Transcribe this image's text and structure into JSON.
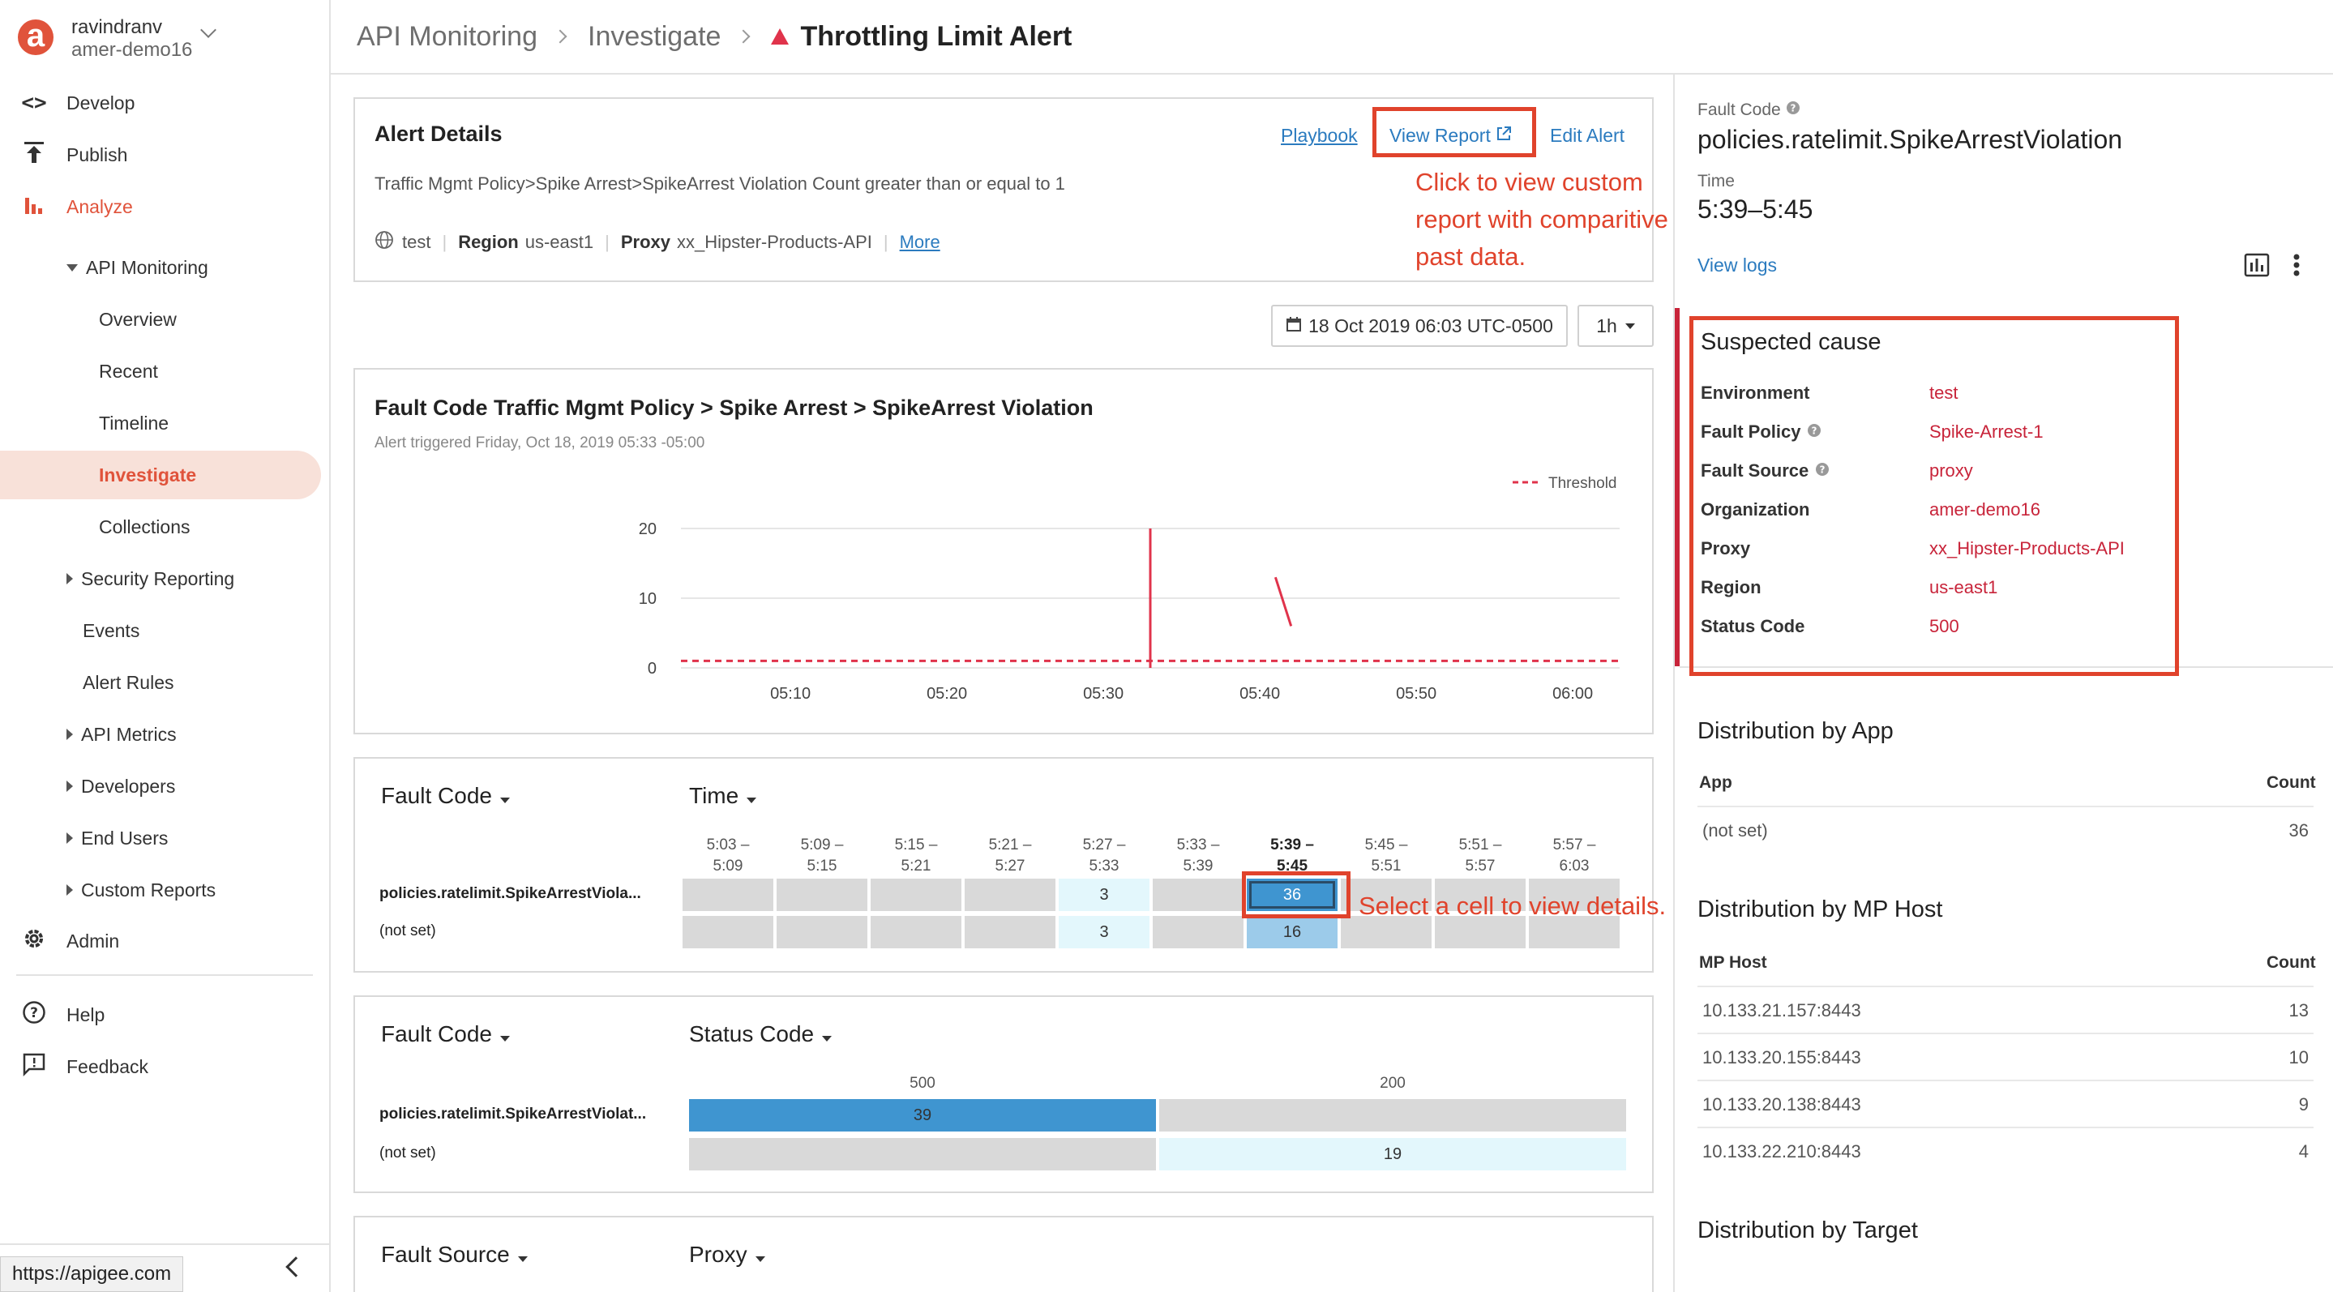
{
  "user": {
    "name": "ravindranv",
    "org": "amer-demo16"
  },
  "nav": {
    "develop": "Develop",
    "publish": "Publish",
    "analyze": "Analyze",
    "api_monitoring": "API Monitoring",
    "overview": "Overview",
    "recent": "Recent",
    "timeline": "Timeline",
    "investigate": "Investigate",
    "collections": "Collections",
    "security_reporting": "Security Reporting",
    "events": "Events",
    "alert_rules": "Alert Rules",
    "api_metrics": "API Metrics",
    "developers": "Developers",
    "end_users": "End Users",
    "custom_reports": "Custom Reports",
    "admin": "Admin",
    "help": "Help",
    "feedback": "Feedback"
  },
  "status_url": "https://apigee.com",
  "breadcrumb": {
    "b1": "API Monitoring",
    "b2": "Investigate",
    "current": "Throttling Limit Alert"
  },
  "alert": {
    "title": "Alert Details",
    "playbook": "Playbook",
    "view_report": "View Report",
    "edit_alert": "Edit Alert",
    "description": "Traffic Mgmt Policy>Spike Arrest>SpikeArrest Violation Count greater than or equal to 1",
    "env": "test",
    "region_label": "Region",
    "region_value": "us-east1",
    "proxy_label": "Proxy",
    "proxy_value": "xx_Hipster-Products-API",
    "more": "More"
  },
  "annotations": {
    "report_l1": "Click to view custom",
    "report_l2": "report with comparitive",
    "report_l3": "past data.",
    "cell": "Select a cell to view details."
  },
  "date_picker": "18 Oct 2019 06:03 UTC-0500",
  "range_picker": "1h",
  "chart_data": {
    "type": "line",
    "title": "Fault Code Traffic Mgmt Policy > Spike Arrest > SpikeArrest Violation",
    "subtitle": "Alert triggered Friday, Oct 18, 2019 05:33 -05:00",
    "legend": "Threshold",
    "legend_position": "top-right",
    "xlabel": "",
    "ylabel": "",
    "x_ticks": [
      "05:10",
      "05:20",
      "05:30",
      "05:40",
      "05:50",
      "06:00"
    ],
    "y_ticks": [
      0,
      10,
      20
    ],
    "ylim": [
      0,
      20
    ],
    "grid": true,
    "threshold": 1,
    "segments": [
      {
        "x": [
          "05:33",
          "05:33"
        ],
        "y": [
          20,
          0
        ]
      },
      {
        "x": [
          "05:41",
          "05:42"
        ],
        "y": [
          13,
          6
        ]
      }
    ]
  },
  "matrix1": {
    "dim1": "Fault Code",
    "dim2": "Time",
    "columns": [
      "5:03 –",
      "5:09 –",
      "5:15 –",
      "5:21 –",
      "5:27 –",
      "5:33 –",
      "5:39 –",
      "5:45 –",
      "5:51 –",
      "5:57 –"
    ],
    "columns2": [
      "5:09",
      "5:15",
      "5:21",
      "5:27",
      "5:33",
      "5:39",
      "5:45",
      "5:51",
      "5:57",
      "6:03"
    ],
    "rows": [
      {
        "label": "policies.ratelimit.SpikeArrestViola...",
        "values": [
          "",
          "",
          "",
          "",
          "3",
          "",
          "36",
          "",
          "",
          ""
        ]
      },
      {
        "label": "(not set)",
        "values": [
          "",
          "",
          "",
          "",
          "3",
          "",
          "16",
          "",
          "",
          ""
        ]
      }
    ]
  },
  "matrix2": {
    "dim1": "Fault Code",
    "dim2": "Status Code",
    "columns": [
      "500",
      "200"
    ],
    "rows": [
      {
        "label": "policies.ratelimit.SpikeArrestViolat...",
        "values": [
          "39",
          ""
        ]
      },
      {
        "label": "(not set)",
        "values": [
          "",
          "19"
        ]
      }
    ]
  },
  "matrix3": {
    "dim1": "Fault Source",
    "dim2": "Proxy"
  },
  "details": {
    "fault_code_label": "Fault Code",
    "fault_code_value": "policies.ratelimit.SpikeArrestViolation",
    "time_label": "Time",
    "time_value": "5:39–5:45",
    "view_logs": "View logs",
    "suspected_title": "Suspected cause",
    "suspected": [
      {
        "k": "Environment",
        "v": "test"
      },
      {
        "k": "Fault Policy",
        "v": "Spike-Arrest-1"
      },
      {
        "k": "Fault Source",
        "v": "proxy"
      },
      {
        "k": "Organization",
        "v": "amer-demo16"
      },
      {
        "k": "Proxy",
        "v": "xx_Hipster-Products-API"
      },
      {
        "k": "Region",
        "v": "us-east1"
      },
      {
        "k": "Status Code",
        "v": "500"
      }
    ],
    "dist_app_title": "Distribution by App",
    "dist_app_hdr_k": "App",
    "dist_app_hdr_v": "Count",
    "dist_app_rows": [
      {
        "k": "(not set)",
        "v": "36"
      }
    ],
    "dist_host_title": "Distribution by MP Host",
    "dist_host_hdr_k": "MP Host",
    "dist_host_hdr_v": "Count",
    "dist_host_rows": [
      {
        "k": "10.133.21.157:8443",
        "v": "13"
      },
      {
        "k": "10.133.20.155:8443",
        "v": "10"
      },
      {
        "k": "10.133.20.138:8443",
        "v": "9"
      },
      {
        "k": "10.133.22.210:8443",
        "v": "4"
      }
    ],
    "dist_target_title": "Distribution by Target"
  },
  "colors": {
    "accent": "#e0533b",
    "link": "#2b7bbf",
    "cause": "#c8243a",
    "cell_selected": "#3f95d0",
    "cell_light": "#e3f7fc",
    "cell_mid": "#9ccbea"
  }
}
